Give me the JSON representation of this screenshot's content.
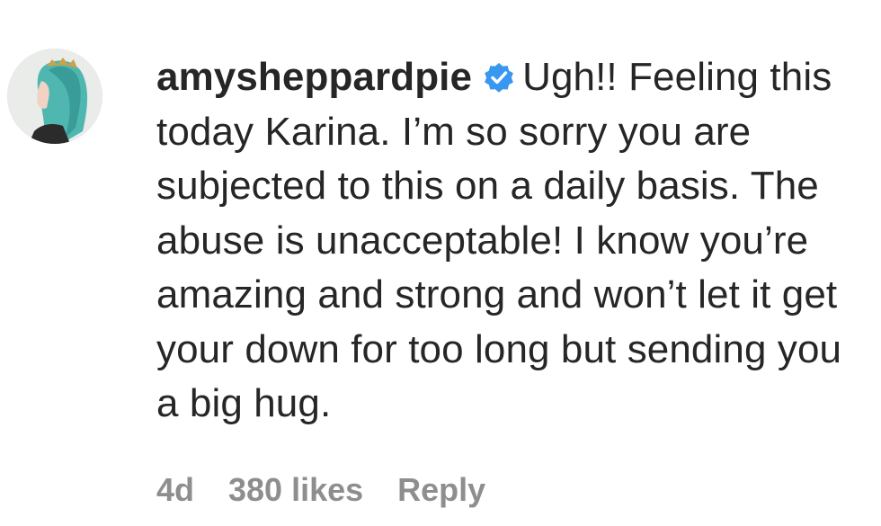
{
  "comment": {
    "username": "amysheppardpie",
    "verified_icon": "verified-badge-icon",
    "text": "Ugh!! Feeling this today Karina. I’m so sorry you are subjected to this on a daily basis. The abuse is unacceptable! I know you’re amazing and strong and won’t let it get your down for too long but sending you a big hug.",
    "time": "4d",
    "likes": "380 likes",
    "reply_label": "Reply"
  },
  "colors": {
    "text": "#262626",
    "meta": "#8e8e8e",
    "verified": "#3897f0"
  }
}
